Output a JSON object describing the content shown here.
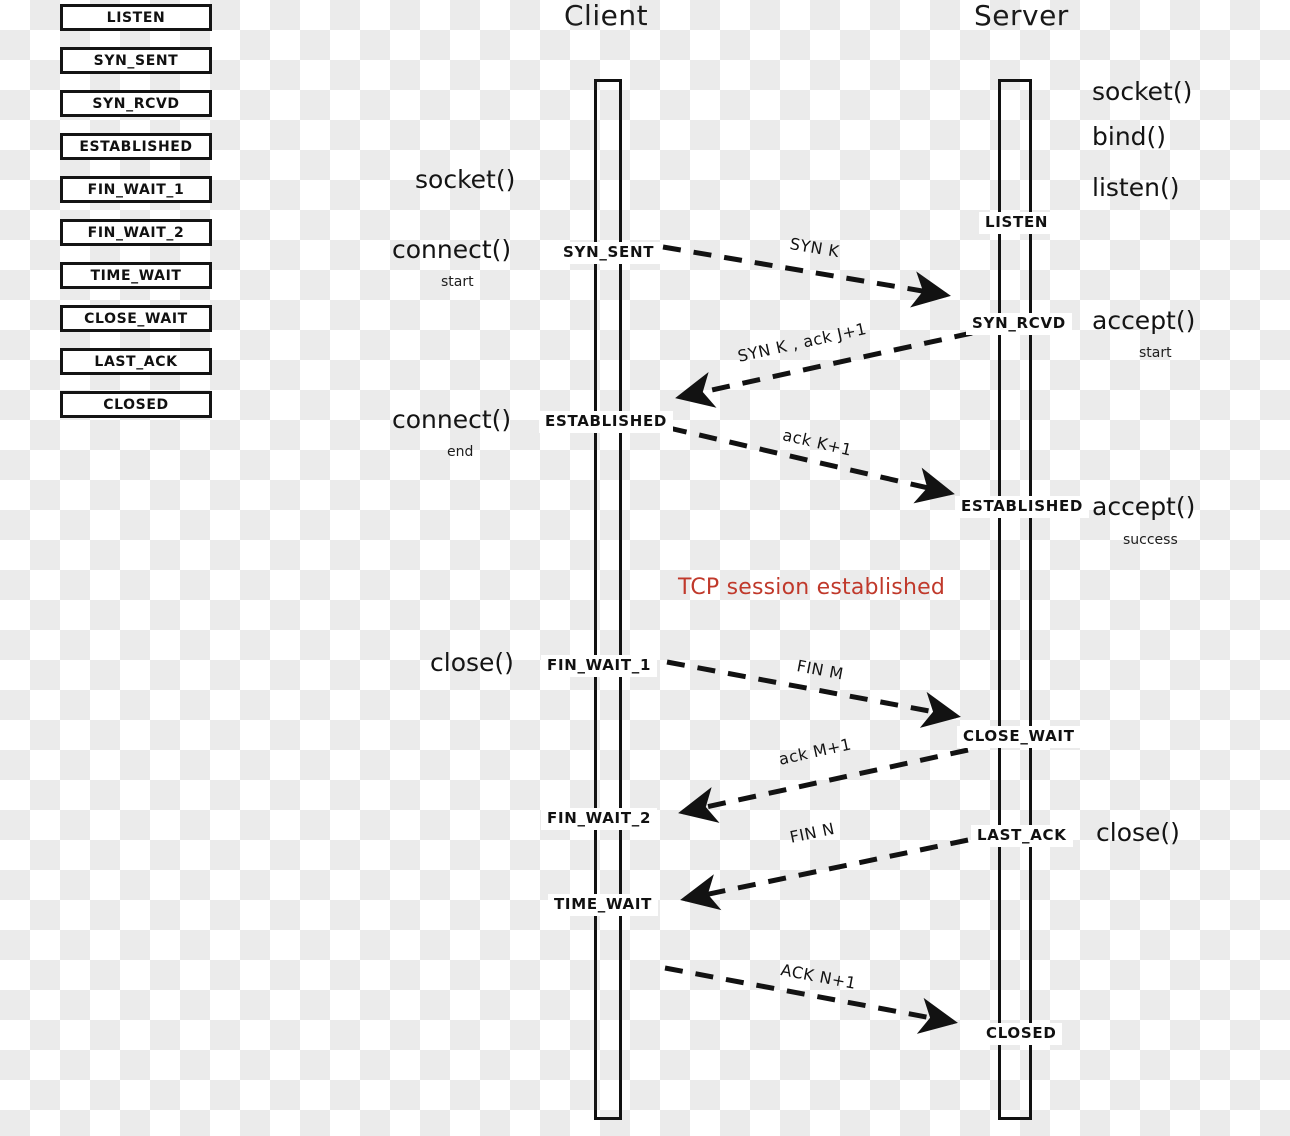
{
  "diagram": {
    "type": "sequence",
    "title_client": "Client",
    "title_server": "Server",
    "accent_red": "#c0392b",
    "ink": "#121212",
    "session_note": "TCP session established"
  },
  "legend": {
    "items": [
      {
        "label": "LISTEN"
      },
      {
        "label": "SYN_SENT"
      },
      {
        "label": "SYN_RCVD"
      },
      {
        "label": "ESTABLISHED"
      },
      {
        "label": "FIN_WAIT_1"
      },
      {
        "label": "FIN_WAIT_2"
      },
      {
        "label": "TIME_WAIT"
      },
      {
        "label": "CLOSE_WAIT"
      },
      {
        "label": "LAST_ACK"
      },
      {
        "label": "CLOSED"
      }
    ]
  },
  "client": {
    "states": [
      {
        "label": "SYN_SENT"
      },
      {
        "label": "ESTABLISHED"
      },
      {
        "label": "FIN_WAIT_1"
      },
      {
        "label": "FIN_WAIT_2"
      },
      {
        "label": "TIME_WAIT"
      }
    ],
    "calls": [
      {
        "label": "socket()",
        "sub": ""
      },
      {
        "label": "connect()",
        "sub": "start"
      },
      {
        "label": "connect()",
        "sub": "end"
      },
      {
        "label": "close()",
        "sub": ""
      }
    ]
  },
  "server": {
    "states": [
      {
        "label": "LISTEN"
      },
      {
        "label": "SYN_RCVD"
      },
      {
        "label": "ESTABLISHED"
      },
      {
        "label": "CLOSE_WAIT"
      },
      {
        "label": "LAST_ACK"
      },
      {
        "label": "CLOSED"
      }
    ],
    "calls": [
      {
        "label": "socket()",
        "sub": ""
      },
      {
        "label": "bind()",
        "sub": ""
      },
      {
        "label": "listen()",
        "sub": ""
      },
      {
        "label": "accept()",
        "sub": "start"
      },
      {
        "label": "accept()",
        "sub": "success"
      },
      {
        "label": "close()",
        "sub": ""
      }
    ]
  },
  "messages": [
    {
      "label": "SYN K",
      "direction": "client-to-server"
    },
    {
      "label": "SYN K , ack J+1",
      "direction": "server-to-client"
    },
    {
      "label": "ack K+1",
      "direction": "client-to-server"
    },
    {
      "label": "FIN M",
      "direction": "client-to-server"
    },
    {
      "label": "ack M+1",
      "direction": "server-to-client"
    },
    {
      "label": "FIN N",
      "direction": "server-to-client"
    },
    {
      "label": "ACK N+1",
      "direction": "client-to-server"
    }
  ]
}
